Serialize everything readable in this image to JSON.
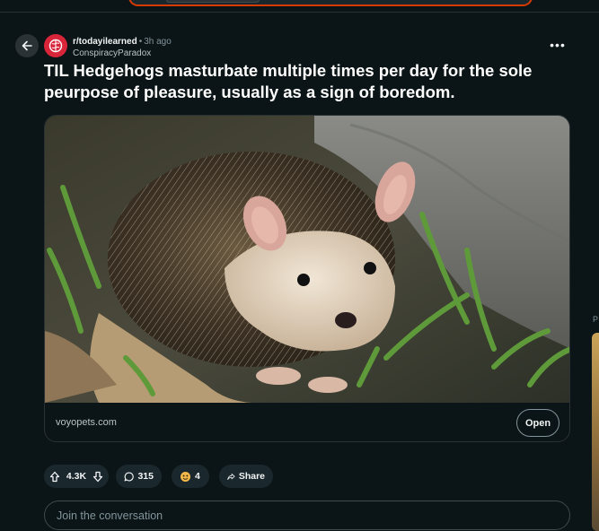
{
  "post": {
    "subreddit": "r/todayilearned",
    "separator": "•",
    "time": "3h ago",
    "author": "ConspiracyParadox",
    "more": "•••",
    "title": "TIL Hedgehogs masturbate multiple times per day for the sole peurpose of pleasure, usually as a sign of boredom."
  },
  "link_card": {
    "domain": "voyopets.com",
    "open_label": "Open"
  },
  "actions": {
    "score": "4.3K",
    "comments": "315",
    "awards": "4",
    "share_label": "Share"
  },
  "comment_input": {
    "placeholder": "Join the conversation"
  },
  "sidebar": {
    "partial_label": "P"
  },
  "colors": {
    "background": "#0b1416",
    "pill": "#1a282d",
    "subreddit_avatar": "#d9253a",
    "search_outline": "#d93a00"
  }
}
